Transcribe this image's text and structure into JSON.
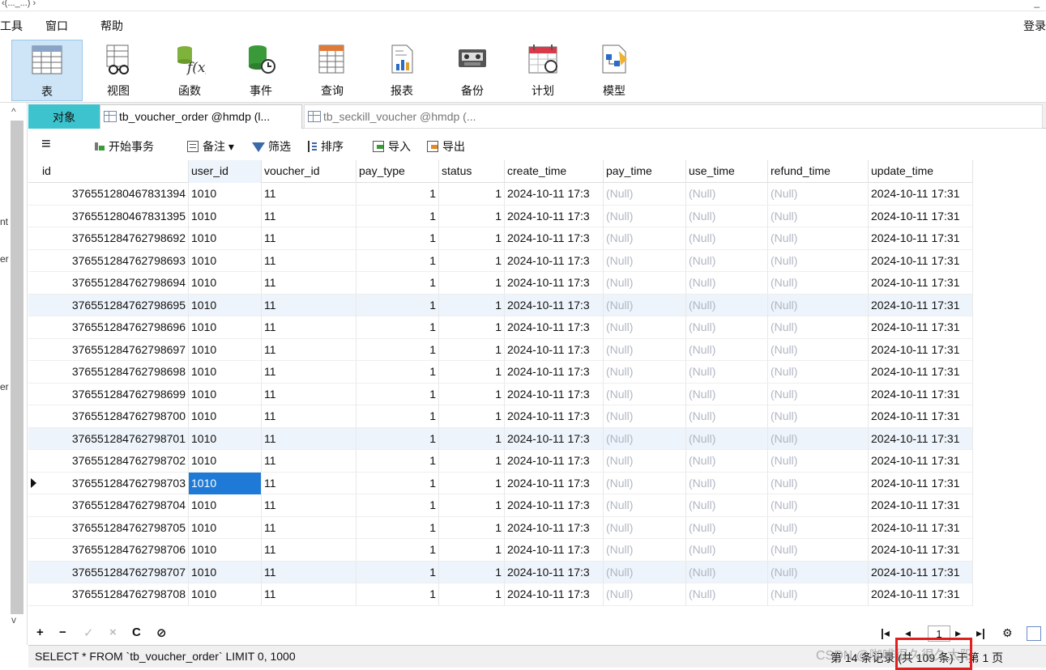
{
  "window": {
    "title_fragment": "‹(..._...) ›",
    "minimize": "_"
  },
  "menu": {
    "tools": "工具",
    "window": "窗口",
    "help": "帮助",
    "login": "登录"
  },
  "ribbon": [
    {
      "label": "表",
      "icon": "table-icon",
      "active": true
    },
    {
      "label": "视图",
      "icon": "view-icon",
      "active": false
    },
    {
      "label": "函数",
      "icon": "function-icon",
      "active": false
    },
    {
      "label": "事件",
      "icon": "event-icon",
      "active": false
    },
    {
      "label": "查询",
      "icon": "query-icon",
      "active": false
    },
    {
      "label": "报表",
      "icon": "report-icon",
      "active": false
    },
    {
      "label": "备份",
      "icon": "backup-icon",
      "active": false
    },
    {
      "label": "计划",
      "icon": "schedule-icon",
      "active": false
    },
    {
      "label": "模型",
      "icon": "model-icon",
      "active": false
    }
  ],
  "left_fragments": [
    "nt",
    "er",
    "er"
  ],
  "tabs": {
    "objects": "对象",
    "tab1": "tb_voucher_order @hmdp (l...",
    "tab2": "tb_seckill_voucher @hmdp (..."
  },
  "toolbar": {
    "menu_icon": "≡",
    "begin_tx": "开始事务",
    "comment": "备注",
    "filter": "筛选",
    "sort": "排序",
    "import": "导入",
    "export": "导出"
  },
  "table": {
    "columns": [
      "id",
      "user_id",
      "voucher_id",
      "pay_type",
      "status",
      "create_time",
      "pay_time",
      "use_time",
      "refund_time",
      "update_time"
    ],
    "rows": [
      [
        "376551280467831394",
        "1010",
        "11",
        "1",
        "1",
        "2024-10-11 17:3",
        "(Null)",
        "(Null)",
        "(Null)",
        "2024-10-11 17:31"
      ],
      [
        "376551280467831395",
        "1010",
        "11",
        "1",
        "1",
        "2024-10-11 17:3",
        "(Null)",
        "(Null)",
        "(Null)",
        "2024-10-11 17:31"
      ],
      [
        "376551284762798692",
        "1010",
        "11",
        "1",
        "1",
        "2024-10-11 17:3",
        "(Null)",
        "(Null)",
        "(Null)",
        "2024-10-11 17:31"
      ],
      [
        "376551284762798693",
        "1010",
        "11",
        "1",
        "1",
        "2024-10-11 17:3",
        "(Null)",
        "(Null)",
        "(Null)",
        "2024-10-11 17:31"
      ],
      [
        "376551284762798694",
        "1010",
        "11",
        "1",
        "1",
        "2024-10-11 17:3",
        "(Null)",
        "(Null)",
        "(Null)",
        "2024-10-11 17:31"
      ],
      [
        "376551284762798695",
        "1010",
        "11",
        "1",
        "1",
        "2024-10-11 17:3",
        "(Null)",
        "(Null)",
        "(Null)",
        "2024-10-11 17:31"
      ],
      [
        "376551284762798696",
        "1010",
        "11",
        "1",
        "1",
        "2024-10-11 17:3",
        "(Null)",
        "(Null)",
        "(Null)",
        "2024-10-11 17:31"
      ],
      [
        "376551284762798697",
        "1010",
        "11",
        "1",
        "1",
        "2024-10-11 17:3",
        "(Null)",
        "(Null)",
        "(Null)",
        "2024-10-11 17:31"
      ],
      [
        "376551284762798698",
        "1010",
        "11",
        "1",
        "1",
        "2024-10-11 17:3",
        "(Null)",
        "(Null)",
        "(Null)",
        "2024-10-11 17:31"
      ],
      [
        "376551284762798699",
        "1010",
        "11",
        "1",
        "1",
        "2024-10-11 17:3",
        "(Null)",
        "(Null)",
        "(Null)",
        "2024-10-11 17:31"
      ],
      [
        "376551284762798700",
        "1010",
        "11",
        "1",
        "1",
        "2024-10-11 17:3",
        "(Null)",
        "(Null)",
        "(Null)",
        "2024-10-11 17:31"
      ],
      [
        "376551284762798701",
        "1010",
        "11",
        "1",
        "1",
        "2024-10-11 17:3",
        "(Null)",
        "(Null)",
        "(Null)",
        "2024-10-11 17:31"
      ],
      [
        "376551284762798702",
        "1010",
        "11",
        "1",
        "1",
        "2024-10-11 17:3",
        "(Null)",
        "(Null)",
        "(Null)",
        "2024-10-11 17:31"
      ],
      [
        "376551284762798703",
        "1010",
        "11",
        "1",
        "1",
        "2024-10-11 17:3",
        "(Null)",
        "(Null)",
        "(Null)",
        "2024-10-11 17:31"
      ],
      [
        "376551284762798704",
        "1010",
        "11",
        "1",
        "1",
        "2024-10-11 17:3",
        "(Null)",
        "(Null)",
        "(Null)",
        "2024-10-11 17:31"
      ],
      [
        "376551284762798705",
        "1010",
        "11",
        "1",
        "1",
        "2024-10-11 17:3",
        "(Null)",
        "(Null)",
        "(Null)",
        "2024-10-11 17:31"
      ],
      [
        "376551284762798706",
        "1010",
        "11",
        "1",
        "1",
        "2024-10-11 17:3",
        "(Null)",
        "(Null)",
        "(Null)",
        "2024-10-11 17:31"
      ],
      [
        "376551284762798707",
        "1010",
        "11",
        "1",
        "1",
        "2024-10-11 17:3",
        "(Null)",
        "(Null)",
        "(Null)",
        "2024-10-11 17:31"
      ],
      [
        "376551284762798708",
        "1010",
        "11",
        "1",
        "1",
        "2024-10-11 17:3",
        "(Null)",
        "(Null)",
        "(Null)",
        "2024-10-11 17:31"
      ]
    ],
    "selected_row": 13,
    "alt_rows": [
      5,
      11,
      17
    ]
  },
  "bottom": {
    "add": "+",
    "remove": "−",
    "apply": "✓",
    "discard": "×",
    "refresh": "C",
    "stop": "⊘",
    "page": "1"
  },
  "status": {
    "sql": "SELECT * FROM `tb_voucher_order` LIMIT 0, 1000",
    "record_info": "第 14 条记录 (共 109 条) 于第 1 页",
    "watermark": "CSDN @咖啡很久很久太阳."
  },
  "colors": {
    "accent": "#3cc3ce",
    "selection": "#1e7ad6",
    "highlight": "#e0201f"
  }
}
